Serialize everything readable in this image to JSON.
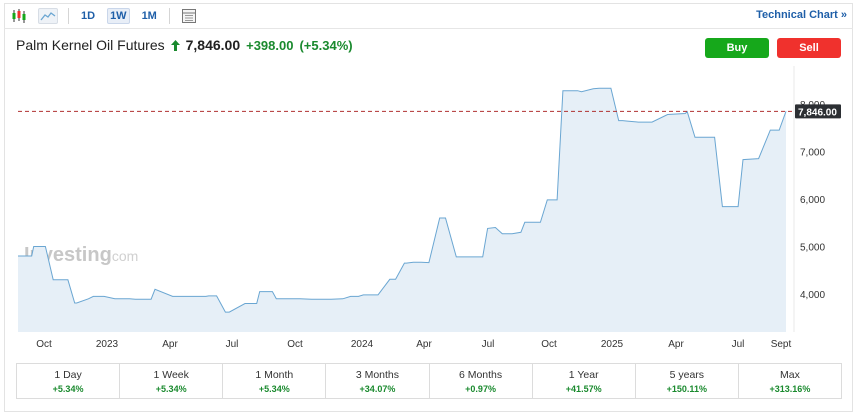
{
  "toolbar": {
    "timeframes": [
      "1D",
      "1W",
      "1M"
    ],
    "active_timeframe": "1W",
    "technical_chart_label": "Technical Chart »"
  },
  "instrument": {
    "name": "Palm Kernel Oil Futures",
    "price": "7,846.00",
    "change": "+398.00",
    "change_pct": "(+5.34%)"
  },
  "actions": {
    "buy_label": "Buy",
    "sell_label": "Sell"
  },
  "watermark": {
    "brand": "Investing",
    "suffix": ".com"
  },
  "chart_data": {
    "type": "area",
    "title": "",
    "y_ticks": [
      "4,000",
      "5,000",
      "6,000",
      "7,000",
      "8,000"
    ],
    "ylim": [
      3200,
      8800
    ],
    "x_labels": [
      "Oct",
      "2023",
      "Apr",
      "Jul",
      "Oct",
      "2024",
      "Apr",
      "Jul",
      "Oct",
      "2025",
      "Apr",
      "Jul",
      "Sept"
    ],
    "current_value": 7846,
    "current_value_label": "7,846.00",
    "x": [
      0,
      14,
      16,
      28,
      36,
      42,
      51,
      58,
      60,
      72,
      77,
      88,
      99,
      110,
      114,
      120,
      124,
      136,
      140,
      158,
      173,
      192,
      195,
      203,
      212,
      216,
      232,
      244,
      247,
      260,
      264,
      276,
      288,
      300,
      320,
      332,
      340,
      348,
      353,
      368,
      380,
      386,
      395,
      397,
      404,
      412,
      420,
      431,
      437,
      448,
      457,
      468,
      475,
      480,
      488,
      495,
      505,
      514,
      518,
      534,
      541,
      551,
      557,
      572,
      576,
      588,
      594,
      606,
      614,
      618,
      623,
      634,
      648,
      664,
      682,
      684,
      692,
      712,
      720,
      736,
      741,
      757,
      769,
      774,
      778,
      785
    ],
    "y": [
      4800,
      4800,
      5000,
      5000,
      4300,
      4300,
      4300,
      3810,
      3810,
      3900,
      3950,
      3950,
      3900,
      3900,
      3900,
      3890,
      3890,
      3890,
      4100,
      3950,
      3950,
      3950,
      3960,
      3960,
      3620,
      3620,
      3800,
      3800,
      4050,
      4050,
      3900,
      3900,
      3900,
      3890,
      3890,
      3900,
      3950,
      3950,
      3980,
      3980,
      4310,
      4310,
      4650,
      4650,
      4670,
      4670,
      4660,
      5600,
      5600,
      4780,
      4780,
      4780,
      4780,
      5380,
      5400,
      5270,
      5270,
      5300,
      5510,
      5510,
      5980,
      5980,
      8280,
      8280,
      8260,
      8320,
      8330,
      8330,
      7650,
      7650,
      7640,
      7620,
      7620,
      7780,
      7800,
      7840,
      7300,
      7300,
      5840,
      5840,
      6830,
      6850,
      7450,
      7450,
      7450,
      7846
    ]
  },
  "colors": {
    "line": "#6aa6d2",
    "area": "#e6eff7",
    "dashed_ref": "#b03030",
    "label_bg": "#2c2f33",
    "positive": "#1a8a2e",
    "link": "#1f5fa8"
  },
  "periods": [
    {
      "label": "1 Day",
      "value": "+5.34%"
    },
    {
      "label": "1 Week",
      "value": "+5.34%"
    },
    {
      "label": "1 Month",
      "value": "+5.34%"
    },
    {
      "label": "3 Months",
      "value": "+34.07%"
    },
    {
      "label": "6 Months",
      "value": "+0.97%"
    },
    {
      "label": "1 Year",
      "value": "+41.57%"
    },
    {
      "label": "5 years",
      "value": "+150.11%"
    },
    {
      "label": "Max",
      "value": "+313.16%"
    }
  ]
}
